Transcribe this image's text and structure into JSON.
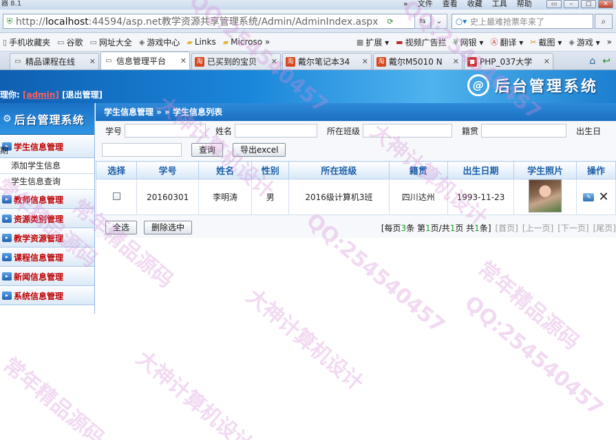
{
  "browser": {
    "title": "器 8.1",
    "menu": [
      "文件",
      "查看",
      "收藏",
      "工具",
      "帮助"
    ],
    "more": "»",
    "window_controls": [
      "▭",
      "–",
      "□",
      "✕"
    ],
    "url_prefix": "http://",
    "url_host": "localhost",
    "url_rest": ":44594/asp.net教学资源共享管理系统/Admin/AdminIndex.aspx",
    "search_placeholder": "史上最难抢票年来了",
    "bookmarks": [
      {
        "label": "手机收藏夹",
        "icon": "phone-icon"
      },
      {
        "label": "谷歌",
        "icon": "page-icon"
      },
      {
        "label": "网址大全",
        "icon": "page-icon"
      },
      {
        "label": "游戏中心",
        "icon": "gamepad-icon"
      },
      {
        "label": "Links",
        "icon": "folder-icon"
      },
      {
        "label": "Microso »",
        "icon": "folder-icon"
      }
    ],
    "bookmarks_right": [
      {
        "label": "扩展 ▾"
      },
      {
        "label": "视频广告拦"
      },
      {
        "label": "网银 ▾"
      },
      {
        "label": "翻译 ▾"
      },
      {
        "label": "截图 ▾"
      },
      {
        "label": "游戏 ▾"
      },
      {
        "label": "»"
      }
    ],
    "tabs": [
      {
        "label": "精品课程在线",
        "icon": "page-icon",
        "active": false
      },
      {
        "label": "信息管理平台",
        "icon": "page-icon",
        "active": true
      },
      {
        "label": "已买到的宝贝",
        "icon": "taobao-icon",
        "active": false
      },
      {
        "label": "戴尔笔记本34",
        "icon": "taobao-icon",
        "active": false
      },
      {
        "label": "戴尔M5010 N",
        "icon": "taobao-icon",
        "active": false
      },
      {
        "label": "PHP_037大学",
        "icon": "php-icon",
        "active": false
      }
    ]
  },
  "header": {
    "welcome_prefix": "理你:",
    "user": "[admin]",
    "logout": "[退出管理]",
    "brand_logo": "@",
    "brand_name": "后台管理系统"
  },
  "sidebar": {
    "title": "后台管理系统",
    "sections": [
      {
        "label": "学生信息管理",
        "items": [
          "添加学生信息",
          "学生信息查询"
        ]
      },
      {
        "label": "教师信息管理",
        "items": []
      },
      {
        "label": "资源类别管理",
        "items": []
      },
      {
        "label": "教学资源管理",
        "items": []
      },
      {
        "label": "课程信息管理",
        "items": []
      },
      {
        "label": "新闻信息管理",
        "items": []
      },
      {
        "label": "系统信息管理",
        "items": []
      }
    ]
  },
  "main": {
    "breadcrumb": "学生信息管理 » » 学生信息列表",
    "filters": {
      "student_no": "学号",
      "name": "姓名",
      "class": "所在班级",
      "native_place": "籍贯",
      "birthday": "出生日",
      "birthday_tail": "期"
    },
    "query_button": "查询",
    "export_button": "导出excel",
    "columns": [
      "选择",
      "学号",
      "姓名",
      "性别",
      "所在班级",
      "籍贯",
      "出生日期",
      "学生照片",
      "操作"
    ],
    "rows": [
      {
        "student_no": "20160301",
        "name": "李明涛",
        "gender": "男",
        "class": "2016级计算机3班",
        "native_place": "四川达州",
        "birthday": "1993-11-23"
      }
    ],
    "select_all_button": "全选",
    "delete_selected_button": "删除选中",
    "pager": {
      "prefix": "[每页",
      "per_page": "3",
      "mid1": "条 第",
      "current": "1",
      "mid2": "页/共",
      "total_pages": "1",
      "mid3": "页 共",
      "total_rows": "1",
      "suffix": "条]",
      "first": "[首页]",
      "prev": "[上一页]",
      "next": "[下一页]",
      "last": "[尾页]"
    }
  },
  "watermark": {
    "lines": [
      "QQ:254540457",
      "大神计算机设计",
      "常年精品源码",
      "QQ:254540457",
      "大神计算机设计",
      "常年精品源码",
      "QQ:254540457",
      "大神计算机设计",
      "常年精品源码",
      "QQ:254540457",
      "大神计算机设计",
      "常年精品源码"
    ]
  }
}
